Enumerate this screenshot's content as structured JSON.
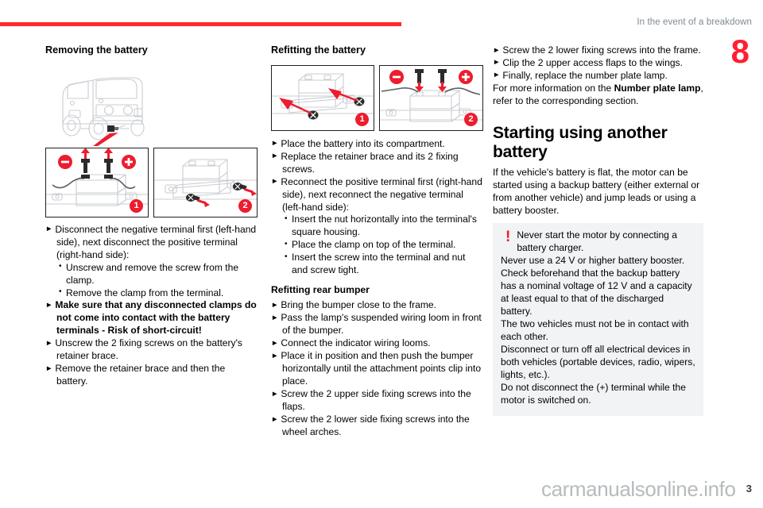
{
  "header": {
    "title": "In the event of a breakdown",
    "chapter_number": "8",
    "rule_color": "#ff2a2a"
  },
  "footer": {
    "watermark": "carmanualsonline.info",
    "page_number": "3"
  },
  "columns": {
    "left": {
      "section_title": "Removing the battery",
      "figures": [
        {
          "badge": "1",
          "caption": "battery terminals with negative and positive clamps being removed"
        },
        {
          "badge": "2",
          "caption": "battery retainer brace fixing screws being unscrewed"
        }
      ],
      "steps": [
        "Disconnect the negative terminal first (left-hand side), next disconnect the positive terminal (right-hand side):"
      ],
      "bullets": [
        "Unscrew and remove the screw from the clamp.",
        "Remove the clamp from the terminal."
      ],
      "warning_step": "Make sure that any disconnected clamps do not come into contact with the battery terminals - Risk of short-circuit!",
      "steps_after": [
        "Unscrew the 2 fixing screws on the battery's retainer brace.",
        "Remove the retainer brace and then the battery."
      ]
    },
    "middle": {
      "section_title": "Refitting the battery",
      "figures": [
        {
          "badge": "1",
          "caption": "retainer brace being screwed back onto the battery"
        },
        {
          "badge": "2",
          "caption": "negative and positive terminal clamps being refitted"
        }
      ],
      "steps": [
        "Place the battery into its compartment.",
        "Replace the retainer brace and its 2 fixing screws.",
        "Reconnect the positive terminal first (right-hand side), next reconnect the negative terminal (left-hand side):"
      ],
      "bullets": [
        "Insert the nut horizontally into the terminal's square housing.",
        "Place the clamp on top of the terminal.",
        "Insert the screw into the terminal and nut and screw tight."
      ],
      "sub_title": "Refitting rear bumper",
      "bumper_steps": [
        "Bring the bumper close to the frame.",
        "Pass the lamp's suspended wiring loom in front of the bumper.",
        "Connect the indicator wiring looms.",
        "Place it in position and then push the bumper horizontally until the attachment points clip into place.",
        "Screw the 2 upper side fixing screws into the flaps.",
        "Screw the 2 lower side fixing screws into the wheel arches."
      ]
    },
    "right": {
      "steps": [
        "Screw the 2 lower fixing screws into the frame.",
        "Clip the 2 upper access flaps to the wings.",
        "Finally, replace the number plate lamp."
      ],
      "cross_reference_pre": "For more information on the ",
      "cross_reference_bold": "Number plate lamp",
      "cross_reference_post": ", refer to the corresponding section.",
      "major_title": "Starting using another battery",
      "intro": "If the vehicle's battery is flat, the motor can be started using a backup battery (either external or from another vehicle) and jump leads or using a battery booster.",
      "warning": {
        "icon": "exclamation-icon",
        "icon_glyph": "!",
        "icon_color": "#ed1c2e",
        "background": "#f1f3f4",
        "first_line": "Never start the motor by connecting a battery charger.",
        "lines": [
          "Never use a 24 V or higher battery booster.",
          "Check beforehand that the backup battery has a nominal voltage of 12 V and a capacity at least equal to that of the discharged battery.",
          "The two vehicles must not be in contact with each other.",
          "Disconnect or turn off all electrical devices in both vehicles (portable devices, radio, wipers, lights, etc.).",
          "Do not disconnect the (+) terminal while the motor is switched on."
        ]
      }
    }
  },
  "glyphs": {
    "arrow": "▶"
  }
}
